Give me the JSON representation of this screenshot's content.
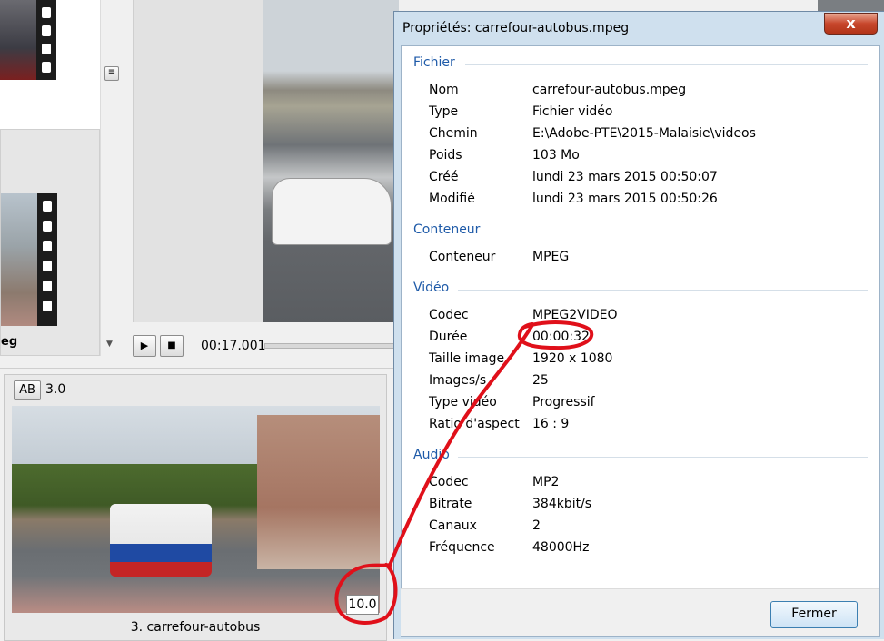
{
  "player": {
    "time": "00:17.001"
  },
  "slide_editor": {
    "ab_label": "AB",
    "ab_value": "3.0",
    "duration_badge": "10.0",
    "caption": "3. carrefour-autobus"
  },
  "thumbnail_list": {
    "partial_label": "eg"
  },
  "dialog": {
    "title": "Propriétés: carrefour-autobus.mpeg",
    "close_label": "x",
    "sections": {
      "fichier": {
        "header": "Fichier",
        "rows": [
          {
            "label": "Nom",
            "value": "carrefour-autobus.mpeg"
          },
          {
            "label": "Type",
            "value": "Fichier vidéo"
          },
          {
            "label": "Chemin",
            "value": "E:\\Adobe-PTE\\2015-Malaisie\\videos"
          },
          {
            "label": "Poids",
            "value": "103 Mo"
          },
          {
            "label": "Créé",
            "value": "lundi 23 mars 2015  00:50:07"
          },
          {
            "label": "Modifié",
            "value": "lundi 23 mars 2015  00:50:26"
          }
        ]
      },
      "conteneur": {
        "header": "Conteneur",
        "rows": [
          {
            "label": "Conteneur",
            "value": "MPEG"
          }
        ]
      },
      "video": {
        "header": "Vidéo",
        "rows": [
          {
            "label": "Codec",
            "value": "MPEG2VIDEO"
          },
          {
            "label": "Durée",
            "value": "00:00:32"
          },
          {
            "label": "Taille image",
            "value": "1920 x 1080"
          },
          {
            "label": "Images/s",
            "value": "25"
          },
          {
            "label": "Type vidéo",
            "value": "Progressif"
          },
          {
            "label": "Ratio d'aspect",
            "value": "16 : 9"
          }
        ]
      },
      "audio": {
        "header": "Audio",
        "rows": [
          {
            "label": "Codec",
            "value": "MP2"
          },
          {
            "label": "Bitrate",
            "value": "384kbit/s"
          },
          {
            "label": "Canaux",
            "value": "2"
          },
          {
            "label": "Fréquence",
            "value": "48000Hz"
          }
        ]
      }
    },
    "fermer_label": "Fermer"
  },
  "colors": {
    "section_header": "#1e5aa8",
    "annotation": "#e0101a",
    "close_button": "#c7472c",
    "dialog_frame": "#cfe0ee"
  }
}
